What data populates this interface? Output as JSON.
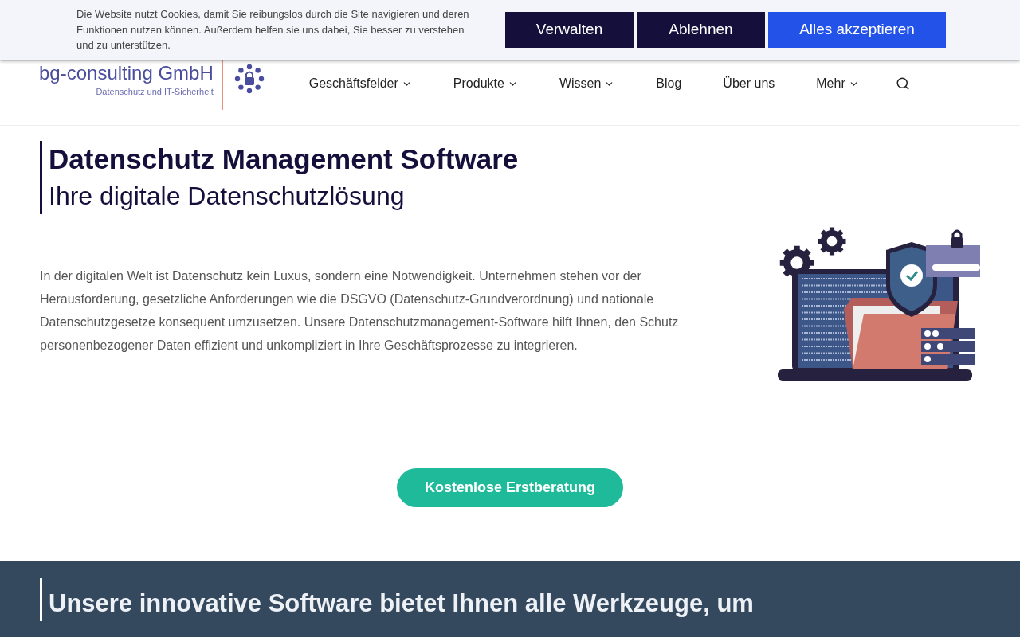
{
  "cookie_banner": {
    "text": "Die Website nutzt Cookies, damit Sie reibungslos durch die Site navigieren und deren Funktionen nutzen können. Außerdem helfen sie uns dabei, Sie besser zu verstehen und zu unterstützen.",
    "buttons": [
      {
        "label": "Verwalten",
        "kind": "dark"
      },
      {
        "label": "Ablehnen",
        "kind": "dark"
      },
      {
        "label": "Alles akzeptieren",
        "kind": "primary"
      }
    ]
  },
  "logo": {
    "name": "bg-consulting GmbH",
    "tagline": "Datenschutz und IT-Sicherheit"
  },
  "nav": [
    {
      "label": "Geschäftsfelder",
      "has_menu": true
    },
    {
      "label": "Produkte",
      "has_menu": true
    },
    {
      "label": "Wissen",
      "has_menu": true
    },
    {
      "label": "Blog",
      "has_menu": false
    },
    {
      "label": "Über uns",
      "has_menu": false
    },
    {
      "label": "Mehr",
      "has_menu": true
    }
  ],
  "hero": {
    "title": "Datenschutz Management Software",
    "subtitle": "Ihre digitale Datenschutzlösung",
    "paragraph": "In der digitalen Welt ist Datenschutz kein Luxus, sondern eine Notwendigkeit. Unternehmen stehen vor der Herausforderung, gesetzliche Anforderungen wie die DSGVO (Datenschutz-Grundverordnung) und nationale Datenschutzgesetze konsequent umzusetzen. Unsere Datenschutzmanagement-Software hilft Ihnen, den Schutz personenbezogener Daten effizient und unkompliziert in Ihre Geschäftsprozesse zu integrieren.",
    "cta": "Kostenlose Erstberatung"
  },
  "feature_band": {
    "heading": "Unsere innovative Software bietet Ihnen alle Werkzeuge, um"
  }
}
